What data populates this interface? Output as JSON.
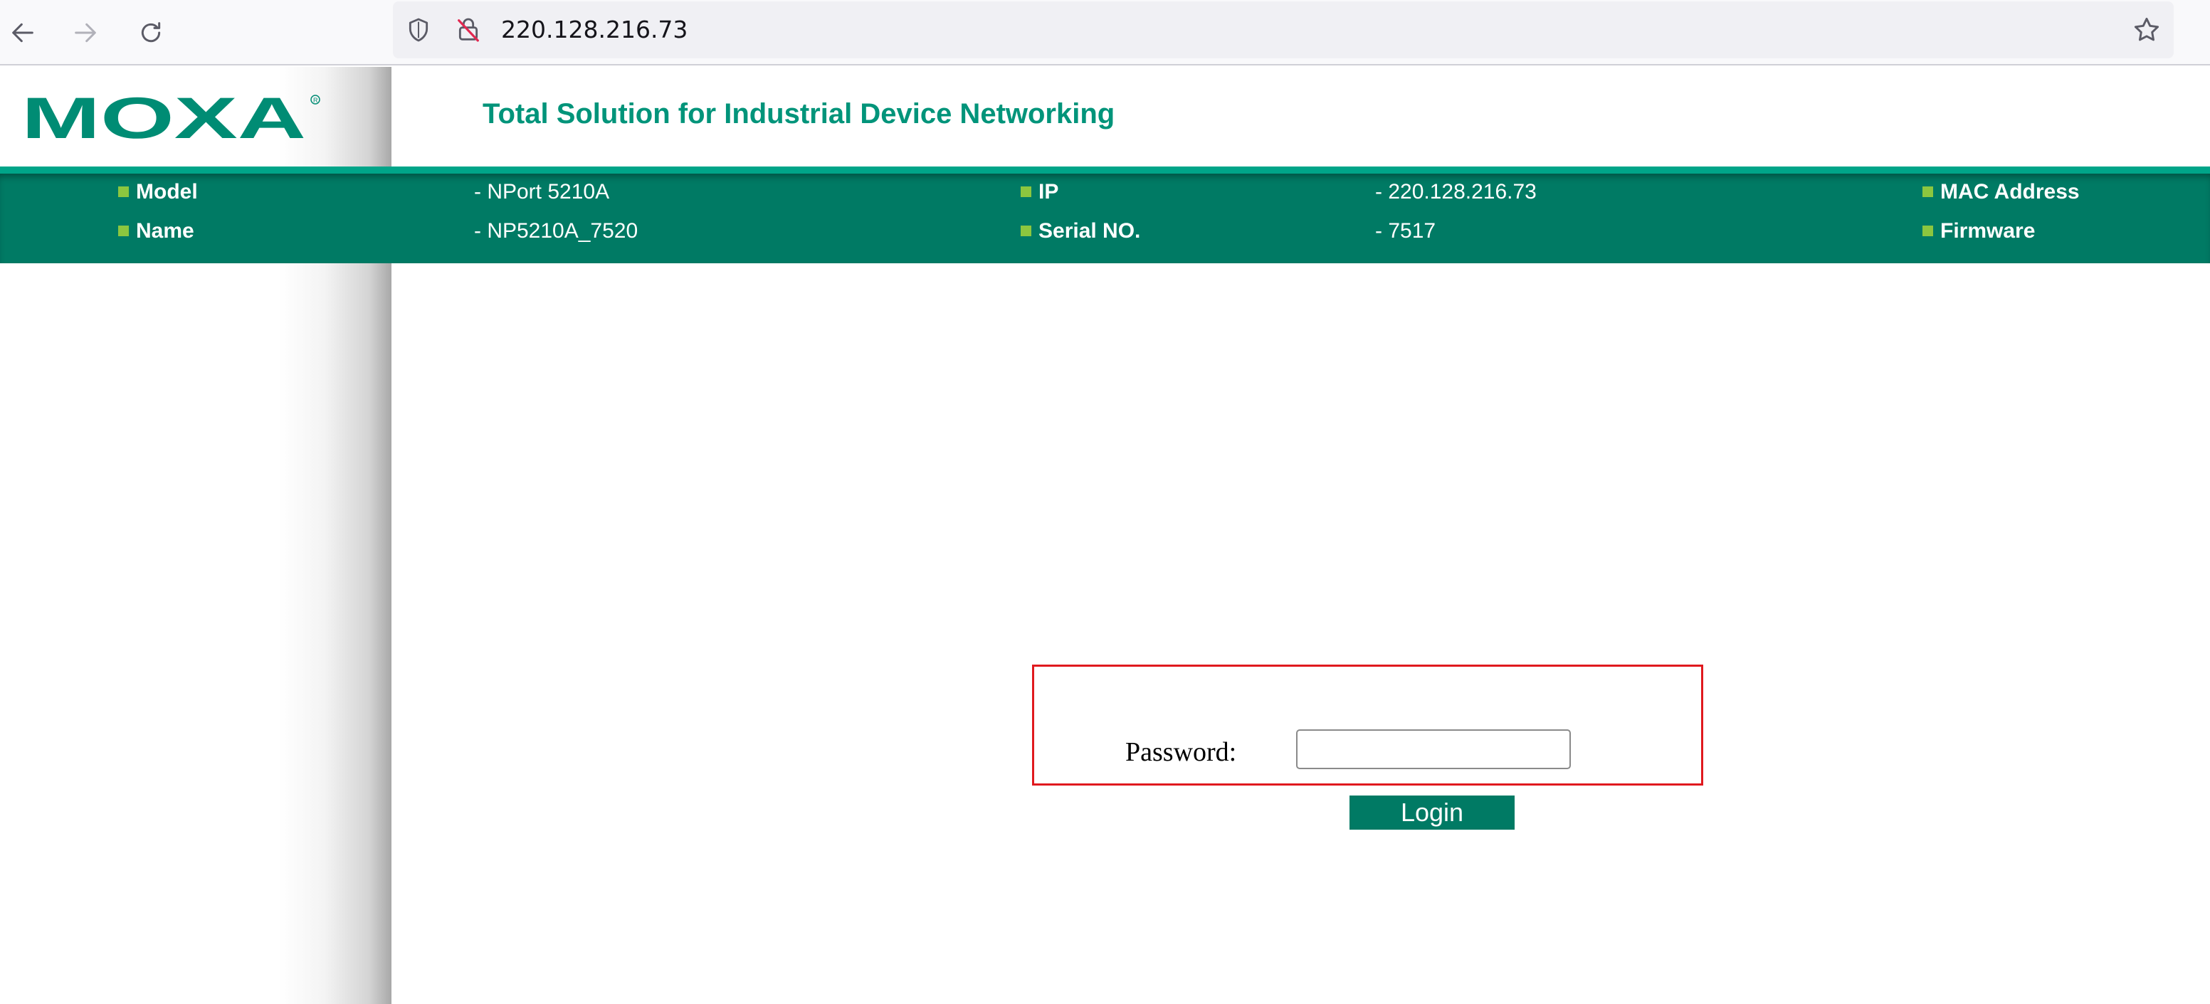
{
  "browser": {
    "url": "220.128.216.73"
  },
  "header": {
    "logo_text": "MOXA",
    "tagline": "Total Solution for Industrial Device Networking"
  },
  "device_info": {
    "model_label": "Model",
    "model_value": "- NPort 5210A",
    "name_label": "Name",
    "name_value": "- NP5210A_7520",
    "ip_label": "IP",
    "ip_value": "- 220.128.216.73",
    "serial_label": "Serial NO.",
    "serial_value": "- 7517",
    "mac_label": "MAC Address",
    "firmware_label": "Firmware"
  },
  "login": {
    "password_label": "Password:",
    "password_value": "",
    "button_label": "Login"
  },
  "colors": {
    "brand_green": "#007a64",
    "tagline_green": "#00947a",
    "bullet_green": "#8cc63f",
    "box_red": "#e0191e"
  },
  "icons": {
    "back": "arrow-left-icon",
    "forward": "arrow-right-icon",
    "reload": "reload-icon",
    "tracking": "shield-icon",
    "insecure": "insecure-lock-icon",
    "bookmark": "star-icon"
  }
}
